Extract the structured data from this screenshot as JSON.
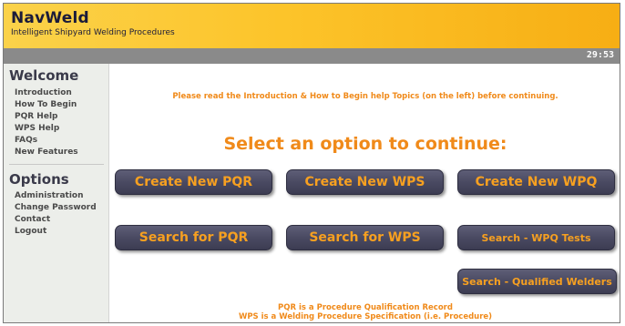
{
  "header": {
    "title": "NavWeld",
    "subtitle": "Intelligent Shipyard Welding Procedures"
  },
  "session": {
    "timer": "29:53"
  },
  "sidebar": {
    "welcome_heading": "Welcome",
    "welcome_items": [
      {
        "label": "Introduction"
      },
      {
        "label": "How To Begin"
      },
      {
        "label": "PQR Help"
      },
      {
        "label": "WPS Help"
      },
      {
        "label": "FAQs"
      },
      {
        "label": "New Features"
      }
    ],
    "options_heading": "Options",
    "options_items": [
      {
        "label": "Administration"
      },
      {
        "label": "Change Password"
      },
      {
        "label": "Contact"
      },
      {
        "label": "Logout"
      }
    ]
  },
  "main": {
    "intro_note": "Please read the Introduction & How to Begin help Topics (on the left) before continuing.",
    "select_heading": "Select an option to continue:",
    "buttons": {
      "create_pqr": "Create New PQR",
      "create_wps": "Create New WPS",
      "create_wpq": "Create New WPQ",
      "search_pqr": "Search for PQR",
      "search_wps": "Search for WPS",
      "search_wpq_tests": "Search - WPQ Tests",
      "search_qualified_welders": "Search - Qualified Welders"
    },
    "footnotes": [
      "PQR is a Procedure Qualification Record",
      "WPS is a Welding Procedure Specification (i.e. Procedure)"
    ]
  },
  "colors": {
    "header_gradient_start": "#fbd24a",
    "header_gradient_end": "#f7ae14",
    "accent_orange": "#f08a1a",
    "button_bg": "#4a4a62",
    "button_text": "#f7a020",
    "timer_bar": "#8a8a8a",
    "sidebar_bg": "#eceeea"
  }
}
